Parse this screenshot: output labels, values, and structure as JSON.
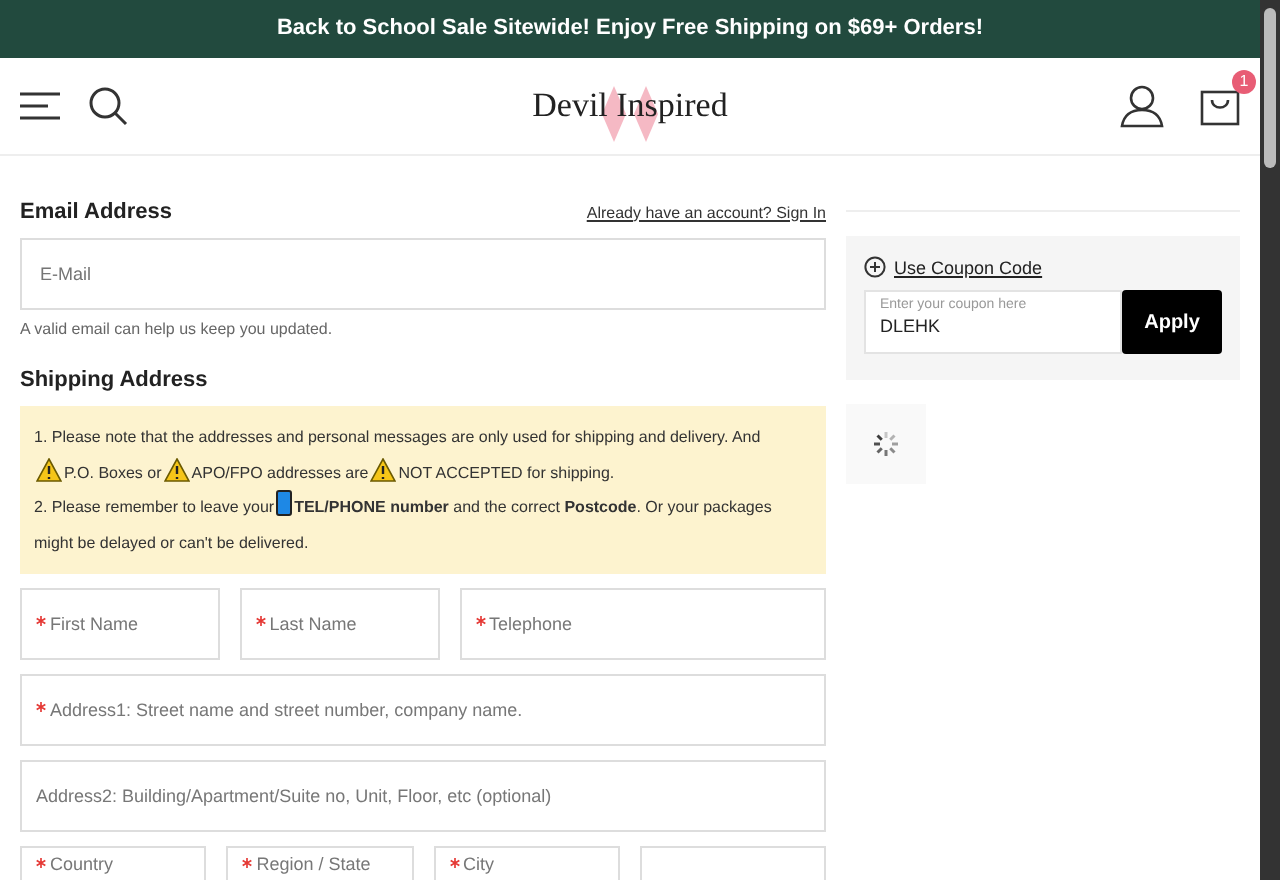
{
  "promo_bar": {
    "text": "Back to School Sale Sitewide! Enjoy Free Shipping on $69+ Orders!"
  },
  "header": {
    "logo": "Devil Inspired",
    "cart_count": "1"
  },
  "email_section": {
    "title": "Email Address",
    "sign_in_link": "Already have an account? Sign In",
    "field": {
      "placeholder": "E-Mail"
    },
    "hint": "A valid email can help us keep you updated."
  },
  "shipping_section": {
    "title": "Shipping Address",
    "notice": [
      {
        "kind": "text",
        "text": "1. Please note that the addresses and personal messages are only used for shipping and delivery. And"
      },
      {
        "kind": "break"
      },
      {
        "kind": "warning"
      },
      {
        "kind": "text",
        "text": "P.O. Boxes or"
      },
      {
        "kind": "warning"
      },
      {
        "kind": "text",
        "text": "APO/FPO addresses are"
      },
      {
        "kind": "warning"
      },
      {
        "kind": "text",
        "text": "NOT ACCEPTED for shipping."
      },
      {
        "kind": "break"
      },
      {
        "kind": "text",
        "text": "2. Please remember to leave your"
      },
      {
        "kind": "phone"
      },
      {
        "kind": "text",
        "text": "**TEL/PHONE number** and the correct **Postcode**. Or your packages"
      },
      {
        "kind": "break"
      },
      {
        "kind": "text",
        "text": "might be delayed or can't be delivered."
      }
    ],
    "field_rows": [
      [
        {
          "placeholder": "First Name",
          "required": true
        },
        {
          "placeholder": "Last Name",
          "required": true
        },
        {
          "placeholder": "Telephone",
          "required": true
        }
      ],
      [
        {
          "placeholder": "Address1: Street name and street number, company name.",
          "required": true
        }
      ],
      [
        {
          "placeholder": "Address2: Building/Apartment/Suite no, Unit, Floor, etc (optional)",
          "required": false
        }
      ],
      [
        {
          "placeholder": "Country",
          "required": true
        },
        {
          "placeholder": "Region / State",
          "required": true
        },
        {
          "placeholder": "City",
          "required": true
        },
        {
          "required": false
        }
      ]
    ]
  },
  "coupon": {
    "link": "Use Coupon Code",
    "label": "Enter your coupon here",
    "value": "DLEHK",
    "button": "Apply"
  }
}
